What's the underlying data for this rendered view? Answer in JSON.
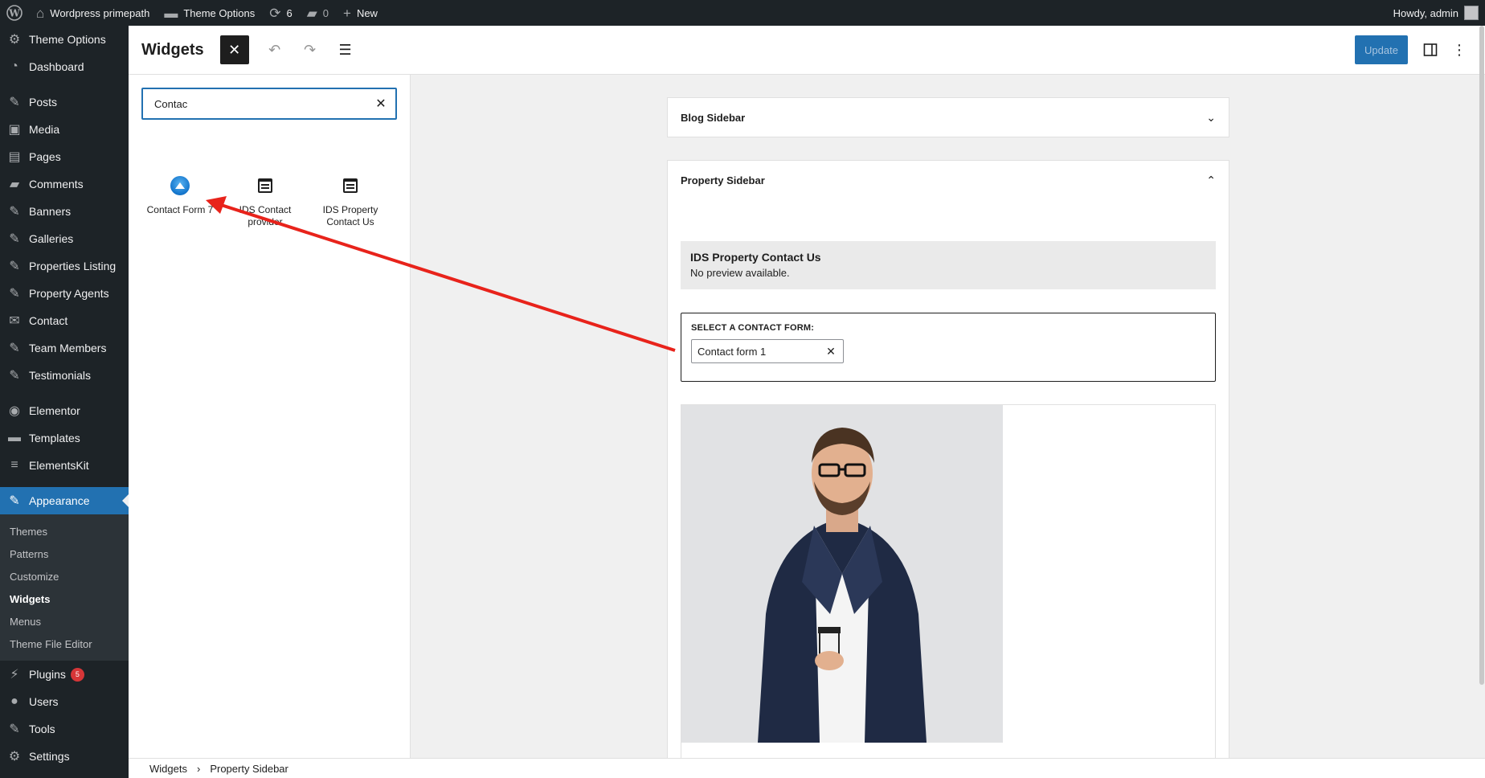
{
  "adminbar": {
    "site_name": "Wordpress primepath",
    "theme_options": "Theme Options",
    "updates_count": "6",
    "comments_count": "0",
    "new_label": "New",
    "greeting": "Howdy, admin"
  },
  "sidebar": {
    "items": [
      {
        "label": "Theme Options",
        "icon": "gear-icon"
      },
      {
        "label": "Dashboard",
        "icon": "dashboard-icon"
      },
      {
        "label": "Posts",
        "icon": "pin-icon"
      },
      {
        "label": "Media",
        "icon": "media-icon"
      },
      {
        "label": "Pages",
        "icon": "pages-icon"
      },
      {
        "label": "Comments",
        "icon": "comment-icon"
      },
      {
        "label": "Banners",
        "icon": "pin-icon"
      },
      {
        "label": "Galleries",
        "icon": "pin-icon"
      },
      {
        "label": "Properties Listing",
        "icon": "pin-icon"
      },
      {
        "label": "Property Agents",
        "icon": "pin-icon"
      },
      {
        "label": "Contact",
        "icon": "mail-icon"
      },
      {
        "label": "Team Members",
        "icon": "pin-icon"
      },
      {
        "label": "Testimonials",
        "icon": "pin-icon"
      },
      {
        "label": "Elementor",
        "icon": "elementor-icon"
      },
      {
        "label": "Templates",
        "icon": "folder-icon"
      },
      {
        "label": "ElementsKit",
        "icon": "ek-icon"
      },
      {
        "label": "Appearance",
        "icon": "brush-icon"
      },
      {
        "label": "Plugins",
        "icon": "plugin-icon",
        "badge": "5"
      },
      {
        "label": "Users",
        "icon": "user-icon"
      },
      {
        "label": "Tools",
        "icon": "wrench-icon"
      },
      {
        "label": "Settings",
        "icon": "settings-icon"
      }
    ],
    "appearance_sub": [
      "Themes",
      "Patterns",
      "Customize",
      "Widgets",
      "Menus",
      "Theme File Editor"
    ]
  },
  "header": {
    "title": "Widgets",
    "update_label": "Update"
  },
  "inserter": {
    "search_value": "Contac",
    "blocks": [
      {
        "label": "Contact Form 7",
        "icon": "contact-form-7-icon"
      },
      {
        "label": "IDS Contact provider",
        "icon": "calendar-icon"
      },
      {
        "label": "IDS Property Contact Us",
        "icon": "calendar-icon"
      }
    ]
  },
  "canvas": {
    "areas": [
      {
        "title": "Blog Sidebar",
        "expanded": false
      },
      {
        "title": "Property Sidebar",
        "expanded": true
      }
    ],
    "preview_title": "IDS Property Contact Us",
    "preview_note": "No preview available.",
    "form_label": "Select a contact form:",
    "form_value": "Contact form 1"
  },
  "footer": {
    "crumbs": [
      "Widgets",
      "Property Sidebar"
    ]
  },
  "colors": {
    "admin_dark": "#1d2327",
    "accent": "#2271b1",
    "annotation_arrow": "#e8231b"
  }
}
